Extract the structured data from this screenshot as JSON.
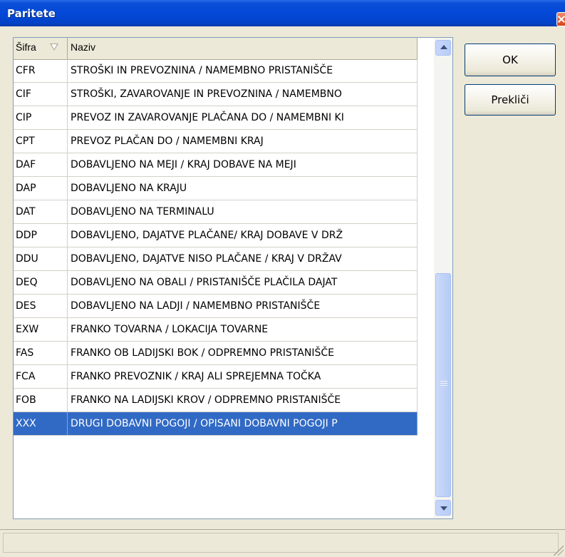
{
  "window": {
    "title": "Paritete"
  },
  "grid": {
    "columns": [
      "Šifra",
      "Naziv"
    ],
    "rows": [
      {
        "code": "CFR",
        "name": "STROŠKI IN PREVOZNINA / NAMEMBNO PRISTANIŠČE"
      },
      {
        "code": "CIF",
        "name": "STROŠKI, ZAVAROVANJE IN PREVOZNINA / NAMEMBNO"
      },
      {
        "code": "CIP",
        "name": "PREVOZ IN ZAVAROVANJE PLAČANA DO / NAMEMBNI KI"
      },
      {
        "code": "CPT",
        "name": "PREVOZ PLAČAN DO / NAMEMBNI KRAJ"
      },
      {
        "code": "DAF",
        "name": "DOBAVLJENO NA MEJI / KRAJ DOBAVE NA MEJI"
      },
      {
        "code": "DAP",
        "name": "DOBAVLJENO NA KRAJU"
      },
      {
        "code": "DAT",
        "name": "DOBAVLJENO NA TERMINALU"
      },
      {
        "code": "DDP",
        "name": "DOBAVLJENO, DAJATVE PLAČANE/ KRAJ DOBAVE V DRŽ"
      },
      {
        "code": "DDU",
        "name": "DOBAVLJENO, DAJATVE NISO PLAČANE / KRAJ V DRŽAV"
      },
      {
        "code": "DEQ",
        "name": "DOBAVLJENO NA OBALI / PRISTANIŠČE PLAČILA DAJAT"
      },
      {
        "code": "DES",
        "name": "DOBAVLJENO NA LADJI / NAMEMBNO PRISTANIŠČE"
      },
      {
        "code": "EXW",
        "name": "FRANKO TOVARNA / LOKACIJA TOVARNE"
      },
      {
        "code": "FAS",
        "name": "FRANKO OB LADIJSKI BOK / ODPREMNO PRISTANIŠČE"
      },
      {
        "code": "FCA",
        "name": "FRANKO PREVOZNIK / KRAJ ALI SPREJEMNA TOČKA"
      },
      {
        "code": "FOB",
        "name": "FRANKO NA LADIJSKI KROV / ODPREMNO PRISTANIŠČE"
      },
      {
        "code": "XXX",
        "name": "DRUGI DOBAVNI POGOJI / OPISANI DOBAVNI POGOJI P"
      }
    ],
    "selected_code": "XXX"
  },
  "buttons": {
    "ok": "OK",
    "cancel": "Prekliči"
  },
  "icons": {
    "sort": "sort-descending-icon",
    "close": "close-icon"
  },
  "colors": {
    "selection": "#316ac5",
    "titlebar": "#0348d8"
  }
}
